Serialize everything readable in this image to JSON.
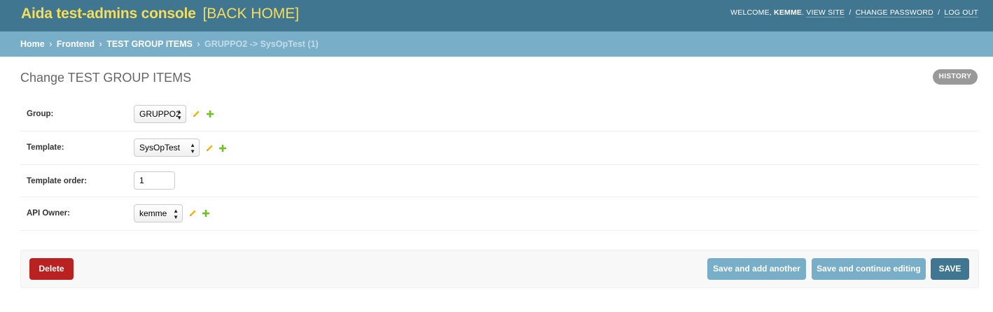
{
  "header": {
    "site_title": "Aida test-admins console",
    "back_home": "[BACK HOME]",
    "welcome": "Welcome,",
    "username": "kemme",
    "view_site": "View site",
    "change_password": "Change password",
    "log_out": "Log out",
    "separator": "/"
  },
  "breadcrumbs": {
    "separator": "›",
    "items": [
      "Home",
      "Frontend",
      "TEST GROUP ITEMS"
    ],
    "current": "GRUPPO2 -> SysOpTest (1)"
  },
  "page": {
    "title": "Change TEST GROUP ITEMS",
    "history_label": "HISTORY"
  },
  "form": {
    "group": {
      "label": "Group:",
      "value": "GRUPPO2"
    },
    "template": {
      "label": "Template:",
      "value": "SysOpTest"
    },
    "template_order": {
      "label": "Template order:",
      "value": "1"
    },
    "api_owner": {
      "label": "API Owner:",
      "value": "kemme"
    }
  },
  "actions": {
    "delete": "Delete",
    "save_add_another": "Save and add another",
    "save_continue": "Save and continue editing",
    "save": "SAVE"
  },
  "colors": {
    "header_bg": "#417690",
    "breadcrumb_bg": "#79aec8",
    "brand_yellow": "#f5dd5d",
    "delete_red": "#ba2121",
    "edit_icon": "#efb80b",
    "add_icon": "#70bf2b"
  },
  "icons": {
    "edit": "pencil-icon",
    "add": "plus-icon"
  }
}
